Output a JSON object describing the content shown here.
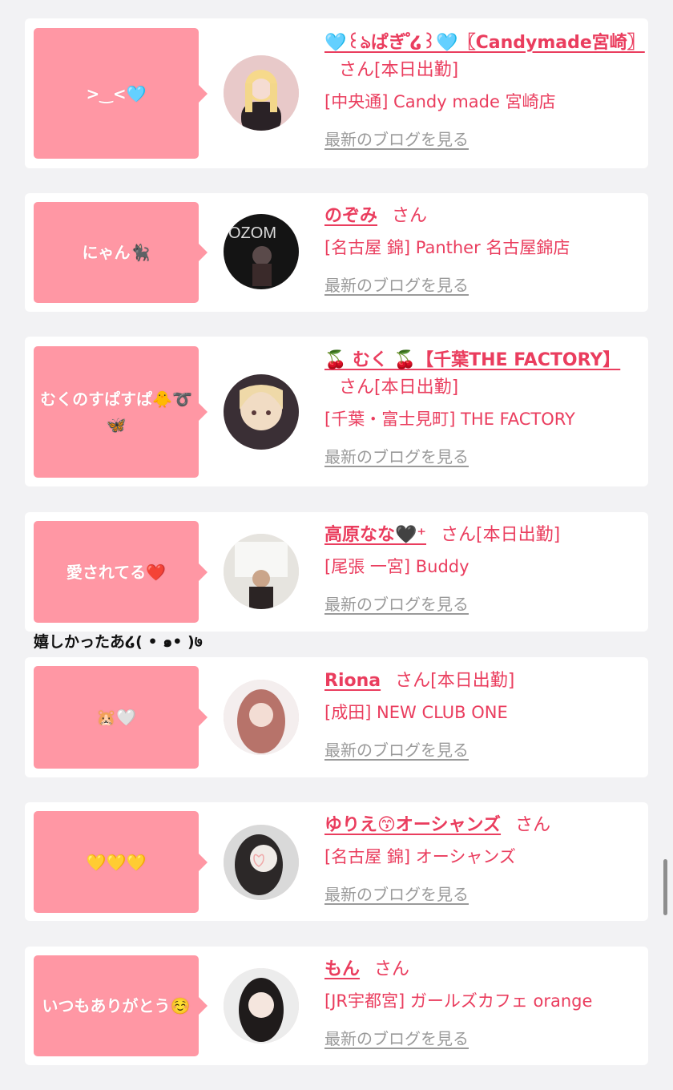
{
  "cards": [
    {
      "message": ">‿<🩵",
      "name": "🩵꒰ঌぱぎ ゚໒꒱🩵〖Candymade宮崎〗",
      "san": "さん",
      "attendance": "[本日出勤]",
      "shop": "[中央通] Candy made 宮崎店",
      "blog": "最新のブログを見る"
    },
    {
      "message": "にゃん🐈‍⬛",
      "name": "のぞみ",
      "san": "さん",
      "attendance": "",
      "shop": "[名古屋 錦] Panther 名古屋錦店",
      "blog": "最新のブログを見る"
    },
    {
      "message": "むくのすぱすぱ🐥➰🦋",
      "name": "🍒 むく 🍒【千葉THE FACTORY】",
      "san": "さん",
      "attendance": "[本日出勤]",
      "shop": "[千葉・富士見町] THE FACTORY",
      "blog": "最新のブログを見る"
    },
    {
      "message": "愛されてる❤️",
      "name": "高原なな🖤⁺",
      "san": "さん",
      "attendance": "[本日出勤]",
      "shop": "[尾張 一宮] Buddy",
      "blog": "最新のブログを見る"
    },
    {
      "message": "🐹🤍",
      "name": "Riona",
      "san": "さん",
      "attendance": "[本日出勤]",
      "shop": "[成田] NEW CLUB ONE",
      "blog": "最新のブログを見る"
    },
    {
      "message": "💛💛💛",
      "name": "ゆりえ😙オーシャンズ",
      "san": "さん",
      "attendance": "",
      "shop": "[名古屋 錦] オーシャンズ",
      "blog": "最新のブログを見る"
    },
    {
      "message": "いつもありがとう☺️",
      "name": "もん",
      "san": "さん",
      "attendance": "",
      "shop": "[JR宇都宮] ガールズカフェ orange",
      "blog": "最新のブログを見る"
    }
  ],
  "floating_text": "嬉しかったあ໒( • ๑• )७",
  "colors": {
    "bubble": "#ff97a4",
    "accent": "#ea3d5e",
    "link_gray": "#9a9a9a",
    "background": "#f2f2f4"
  }
}
